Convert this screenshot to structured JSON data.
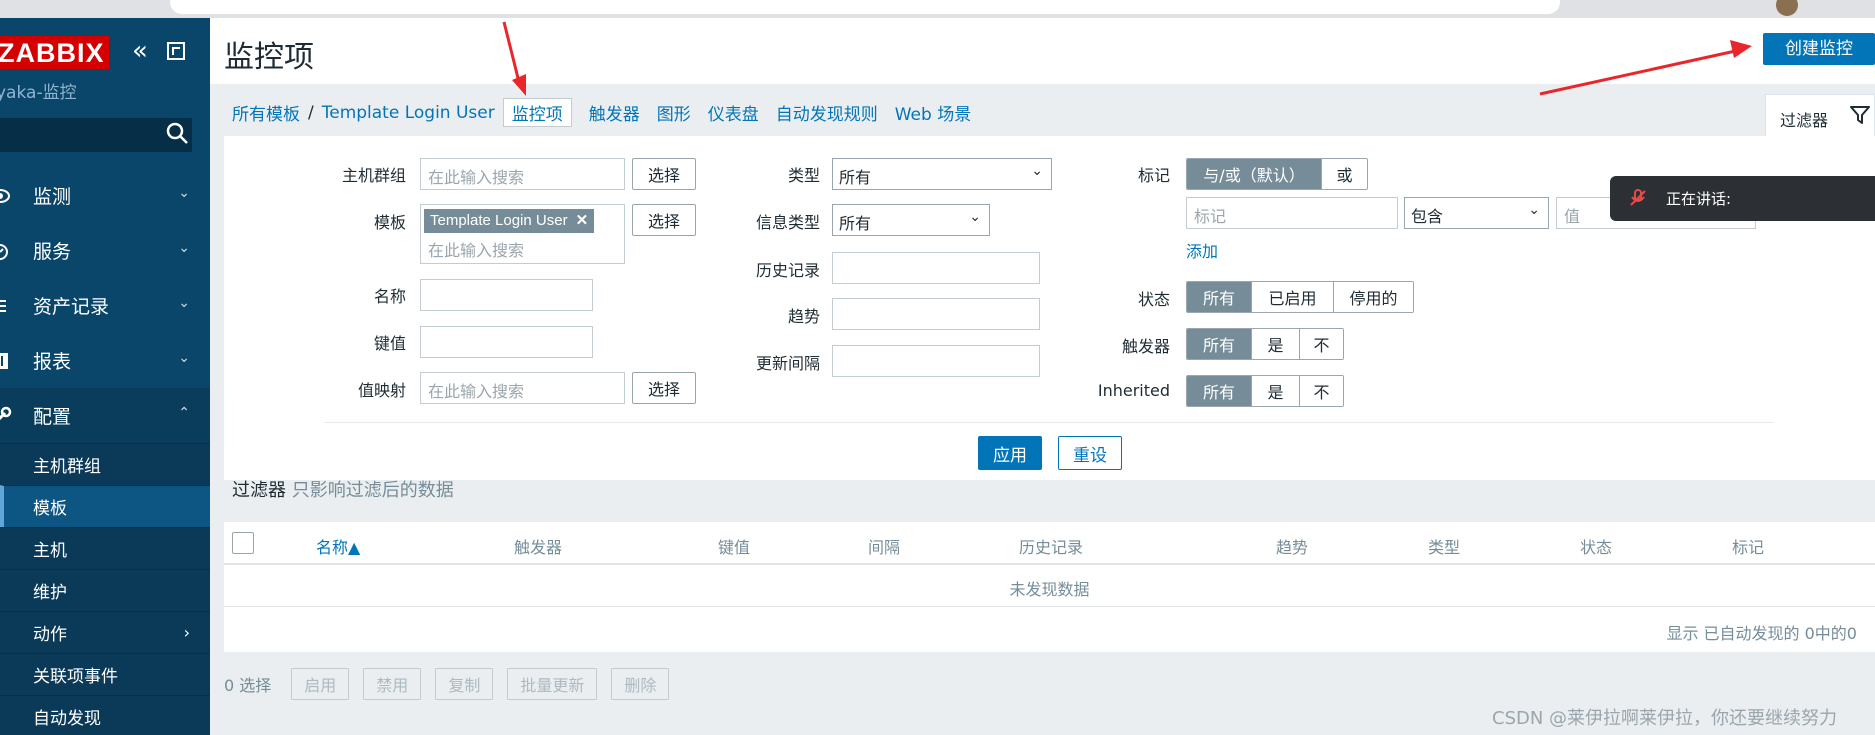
{
  "sidebar": {
    "logo": "ZABBIX",
    "server_name": "yaka-监控",
    "nav": [
      {
        "label": "监测",
        "icon": "eye-icon"
      },
      {
        "label": "服务",
        "icon": "clock-icon"
      },
      {
        "label": "资产记录",
        "icon": "list-icon"
      },
      {
        "label": "报表",
        "icon": "report-icon"
      },
      {
        "label": "配置",
        "icon": "wrench-icon"
      }
    ],
    "config_sub": [
      "主机群组",
      "模板",
      "主机",
      "维护",
      "动作",
      "关联项事件",
      "自动发现"
    ],
    "active_sub": "模板"
  },
  "header": {
    "title": "监控项",
    "create_button": "创建监控项"
  },
  "breadcrumb": {
    "all_templates": "所有模板",
    "separator": "/",
    "template": "Template Login User",
    "tabs": [
      "监控项",
      "触发器",
      "图形",
      "仪表盘",
      "自动发现规则",
      "Web 场景"
    ],
    "active_tab": "监控项"
  },
  "filter_tab": "过滤器",
  "filter": {
    "host_group_label": "主机群组",
    "host_group_placeholder": "在此输入搜索",
    "select_label": "选择",
    "template_label": "模板",
    "template_chip": "Template Login User",
    "template_placeholder": "在此输入搜索",
    "name_label": "名称",
    "key_label": "键值",
    "valuemap_label": "值映射",
    "valuemap_placeholder": "在此输入搜索",
    "type_label": "类型",
    "type_value": "所有",
    "info_type_label": "信息类型",
    "info_type_value": "所有",
    "history_label": "历史记录",
    "trends_label": "趋势",
    "interval_label": "更新间隔",
    "tags_label": "标记",
    "tags_andor": "与/或（默认）",
    "tags_or": "或",
    "tag_placeholder": "标记",
    "tag_operator": "包含",
    "tag_value_placeholder": "值",
    "add_link": "添加",
    "state_label": "状态",
    "state_options": [
      "所有",
      "已启用",
      "停用的"
    ],
    "triggers_label": "触发器",
    "triggers_options": [
      "所有",
      "是",
      "不"
    ],
    "inherited_label": "Inherited",
    "inherited_options": [
      "所有",
      "是",
      "不"
    ],
    "apply": "应用",
    "reset": "重设"
  },
  "speaking": "正在讲话:",
  "filter_note": {
    "label": "过滤器",
    "hint": "只影响过滤后的数据"
  },
  "table": {
    "columns": [
      "名称▲",
      "触发器",
      "键值",
      "间隔",
      "历史记录",
      "趋势",
      "类型",
      "状态",
      "标记"
    ],
    "empty": "未发现数据",
    "paging": "显示 已自动发现的 0中的0"
  },
  "actions": {
    "selected": "0 选择",
    "buttons": [
      "启用",
      "禁用",
      "复制",
      "批量更新",
      "删除"
    ]
  },
  "watermark": "CSDN @莱伊拉啊莱伊拉，你还要继续努力",
  "colors": {
    "sidebar": "#0a466a",
    "primary": "#0275b8",
    "logo": "#d40000",
    "annotation_arrow": "#e8262b"
  }
}
